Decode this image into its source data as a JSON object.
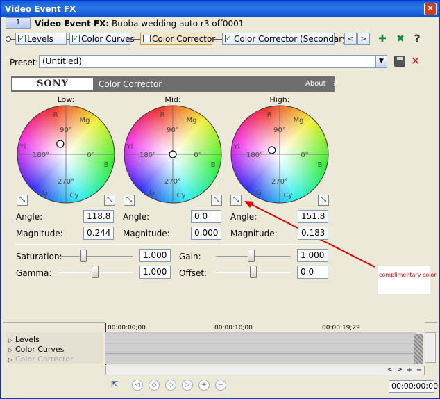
{
  "window": {
    "title": "Video Event FX",
    "close": "✕"
  },
  "header": {
    "badge": "1",
    "title_bold": "Video Event FX:",
    "title_rest": "Bubba wedding auto r3 off0001"
  },
  "chain": [
    {
      "label": "Levels",
      "checked": true
    },
    {
      "label": "Color Curves",
      "checked": true
    },
    {
      "label": "Color Corrector",
      "checked": false,
      "selected": true
    },
    {
      "label": "Color Corrector (Secondary)",
      "checked": true
    }
  ],
  "nav": {
    "prev": "<",
    "next": ">"
  },
  "icons": {
    "add_plugin": "plug-add-icon",
    "remove_plugin": "plug-remove-icon",
    "help": "help-icon"
  },
  "preset": {
    "label": "Preset:",
    "value": "(Untitled)"
  },
  "plugin": {
    "brand": "SONY",
    "name": "Color Corrector",
    "about": "About",
    "help": "?"
  },
  "wheels": {
    "low": {
      "label": "Low:",
      "angle_label": "Angle:",
      "angle": "118.8",
      "magnitude_label": "Magnitude:",
      "magnitude": "0.244"
    },
    "mid": {
      "label": "Mid:",
      "angle_label": "Angle:",
      "angle": "0.0",
      "magnitude_label": "Magnitude:",
      "magnitude": "0.000"
    },
    "high": {
      "label": "High:",
      "angle_label": "Angle:",
      "angle": "151.8",
      "magnitude_label": "Magnitude:",
      "magnitude": "0.183"
    },
    "marks": {
      "R": "R",
      "Mg": "Mg",
      "B": "B",
      "Cy": "Cy",
      "G": "G",
      "Yl": "Yl",
      "a90": "90°",
      "a180": "180°",
      "a0": "0°",
      "a270": "270°"
    }
  },
  "controls": {
    "saturation": {
      "label": "Saturation:",
      "value": "1.000"
    },
    "gamma": {
      "label": "Gamma:",
      "value": "1.000"
    },
    "gain": {
      "label": "Gain:",
      "value": "1.000"
    },
    "offset": {
      "label": "Offset:",
      "value": "0.0"
    }
  },
  "annotation": {
    "text": "complimentary color",
    "color": "#e00000"
  },
  "timeline": {
    "tracks": [
      "Levels",
      "Color Curves",
      "Color Corrector"
    ],
    "ticks": [
      "00:00:00;00",
      "00:00:10;00",
      "00:00:19;29"
    ],
    "time": "00:00:00;00"
  }
}
